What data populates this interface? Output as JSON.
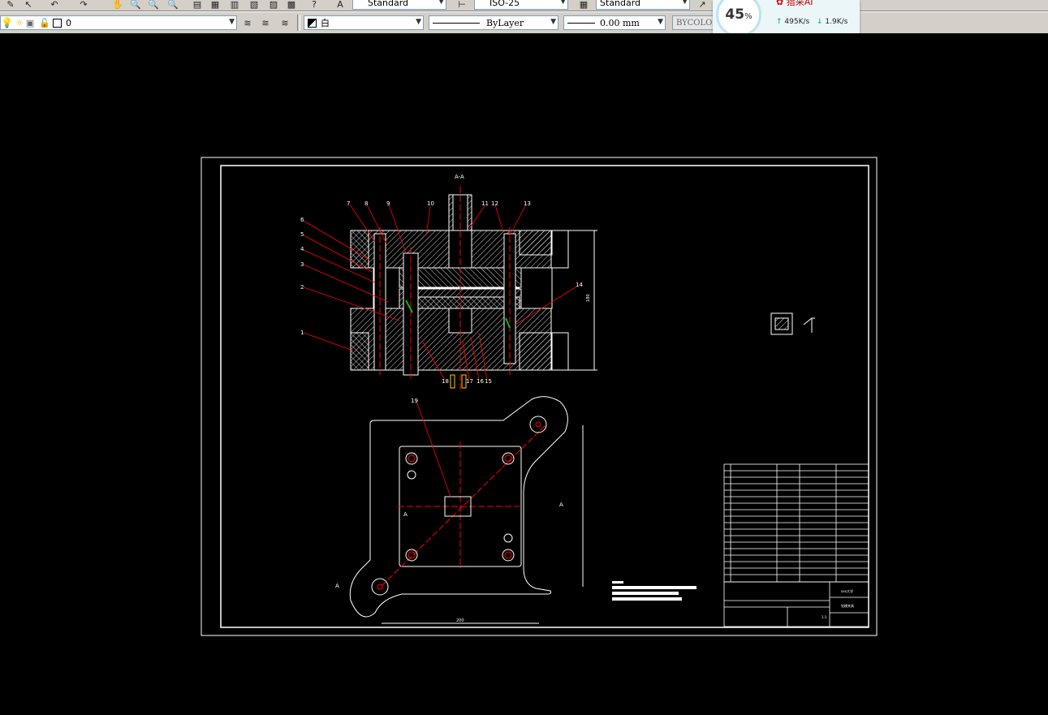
{
  "toolbar_top": {
    "text_style": "Standard",
    "dim_style": "ISO-25",
    "table_style": "Standard"
  },
  "toolbar_bottom": {
    "layer": "0",
    "color": "白",
    "linetype": "ByLayer",
    "lineweight": "0.00 mm",
    "plotstyle": "BYCOLOR"
  },
  "net_widget": {
    "percent": "45",
    "percent_unit": "%",
    "app_name": "猎采AI",
    "upload": "495K/s",
    "download": "1.9K/s"
  },
  "drawing": {
    "section_label": "A-A",
    "section_part_labels": [
      "1",
      "2",
      "3",
      "4",
      "5",
      "6",
      "7",
      "8",
      "9",
      "10",
      "11",
      "12",
      "13",
      "14",
      "15",
      "16",
      "17",
      "18",
      "19"
    ],
    "plan_cut_label": "A",
    "dim_overall_width": "200",
    "dim_overall_height": "180",
    "title_school": "xxx大学",
    "title_name": "钻模夹具",
    "title_scale": "1:1",
    "colors": {
      "sheet_line": "#ffffff",
      "leader": "#ff0000",
      "hatch": "#ffffff",
      "center": "#ff0000",
      "green": "#00c000"
    }
  }
}
